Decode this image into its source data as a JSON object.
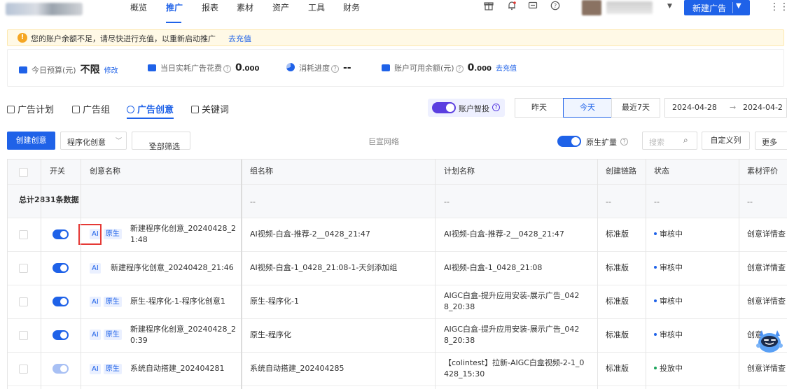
{
  "nav": {
    "items": [
      "概览",
      "推广",
      "报表",
      "素材",
      "资产",
      "工具",
      "财务"
    ],
    "active_index": 1,
    "new_ad_label": "新建广告"
  },
  "warning": {
    "text": "您的账户余额不足，请尽快进行充值，以重新启动推广",
    "link": "去充值"
  },
  "stats": {
    "budget_label": "今日预算(元)",
    "budget_value": "不限",
    "budget_link": "修改",
    "spend_label": "当日实耗广告花费",
    "spend_value_int": "0",
    "spend_value_dec": ".000",
    "progress_label": "消耗进度",
    "progress_value": "--",
    "balance_label": "账户可用余额(元)",
    "balance_value_int": "0",
    "balance_value_dec": ".000",
    "balance_link": "去充值"
  },
  "tabs": [
    "广告计划",
    "广告组",
    "广告创意",
    "关键词"
  ],
  "active_tab": 2,
  "smart_bid": {
    "label": "账户智投",
    "on": true
  },
  "day_buttons": [
    "昨天",
    "今天",
    "最近7天"
  ],
  "active_day": 1,
  "date_range": {
    "start": "2024-04-28",
    "arrow": "→",
    "end": "2024-04-2"
  },
  "toolbar": {
    "create_label": "创建创意",
    "type_select": "程序化创意",
    "filter_label": "全部筛选",
    "network_label": "巨宣网络",
    "expand_label": "原生扩量",
    "search_placeholder": "搜索",
    "custom_cols_label": "自定义列",
    "more_label": "更多"
  },
  "table": {
    "headers": [
      "开关",
      "创意名称",
      "组名称",
      "计划名称",
      "创建链路",
      "状态",
      "素材评价"
    ],
    "summary_label": "总计2831条数据",
    "summary_placeholder": "--",
    "rows": [
      {
        "tags": [
          "AI",
          "原生"
        ],
        "name_l1": "新建程序化创意_20240428_2",
        "name_l2": "1:48",
        "group": "AI视频-白盒-推荐-2__0428_21:47",
        "plan_l1": "AI视频-白盒-推荐-2__0428_21:47",
        "plan_l2": "",
        "chain": "标准版",
        "status": "审核中",
        "status_color": "blue",
        "eval": "创意详情查"
      },
      {
        "tags": [
          "AI"
        ],
        "name_l1": "新建程序化创意_20240428_21:46",
        "name_l2": "",
        "group": "AI视频-白盒-1_0428_21:08-1-天剑添加组",
        "plan_l1": "AI视频-白盒-1_0428_21:08",
        "plan_l2": "",
        "chain": "标准版",
        "status": "审核中",
        "status_color": "blue",
        "eval": "创意详情查"
      },
      {
        "tags": [
          "AI",
          "原生"
        ],
        "name_l1": "原生-程序化-1-程序化创意1",
        "name_l2": "",
        "group": "原生-程序化-1",
        "plan_l1": "AIGC白盒-提升应用安装-展示广告_042",
        "plan_l2": "8_20:38",
        "chain": "标准版",
        "status": "审核中",
        "status_color": "blue",
        "eval": "创意详情查"
      },
      {
        "tags": [
          "AI",
          "原生"
        ],
        "name_l1": "新建程序化创意_20240428_2",
        "name_l2": "0:39",
        "group": "原生-程序化",
        "plan_l1": "AIGC白盒-提升应用安装-展示广告_042",
        "plan_l2": "8_20:38",
        "chain": "标准版",
        "status": "审核中",
        "status_color": "blue",
        "eval": "创意"
      },
      {
        "tags": [
          "AI",
          "原生"
        ],
        "name_l1": "系统自动搭建_202404281",
        "name_l2": "",
        "group": "系统自动搭建_202404285",
        "plan_l1": "【colintest】拉新-AIGC白盒视频-2-1_0",
        "plan_l2": "428_15:30",
        "chain": "标准版",
        "status": "投放中",
        "status_color": "green",
        "eval": "创意详情查"
      }
    ]
  }
}
